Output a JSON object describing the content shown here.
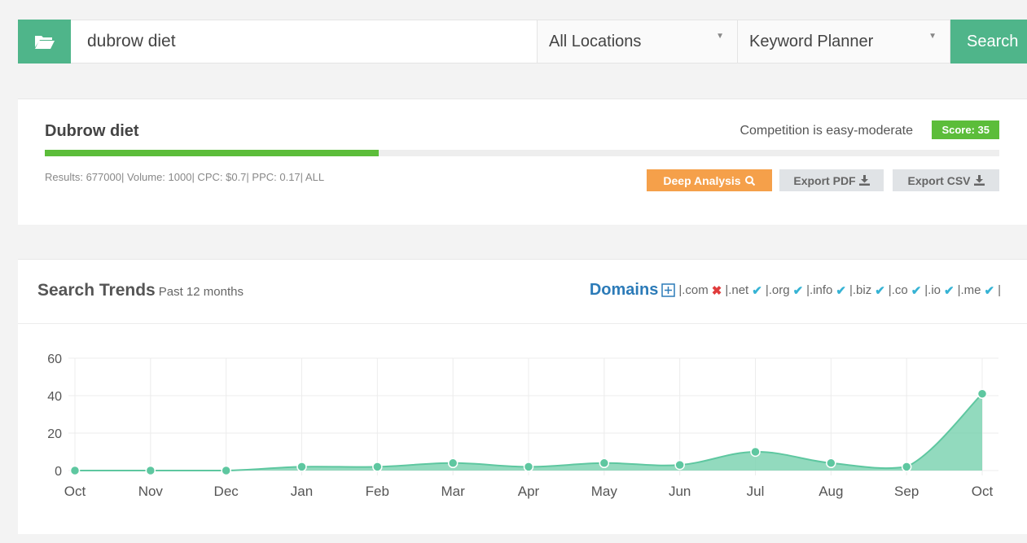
{
  "search": {
    "query": "dubrow diet",
    "location": "All Locations",
    "source": "Keyword Planner",
    "button_label": "Search"
  },
  "keyword": {
    "title": "Dubrow diet",
    "competition": "Competition is easy-moderate",
    "score": "Score: 35",
    "difficulty_fraction": 0.35,
    "stats": "Results: 677000| Volume: 1000| CPC: $0.7| PPC: 0.17| ALL",
    "deep_label": "Deep Analysis",
    "pdf_label": "Export PDF",
    "csv_label": "Export CSV"
  },
  "trends": {
    "title": "Search Trends",
    "subtitle": "Past 12 months",
    "domains_label": "Domains",
    "domains": [
      {
        "tld": "|.com",
        "available": false
      },
      {
        "tld": "|.net",
        "available": true
      },
      {
        "tld": "|.org",
        "available": true
      },
      {
        "tld": "|.info",
        "available": true
      },
      {
        "tld": "|.biz",
        "available": true
      },
      {
        "tld": "|.co",
        "available": true
      },
      {
        "tld": "|.io",
        "available": true
      },
      {
        "tld": "|.me",
        "available": true
      }
    ],
    "trailing": "|"
  },
  "colors": {
    "brand": "#4fb58a",
    "score": "#5cbd3a",
    "deep": "#f5a04a",
    "area_fill": "#7fd3b3",
    "area_line": "#5ec7a0"
  },
  "chart_data": {
    "type": "area",
    "categories": [
      "Oct",
      "Nov",
      "Dec",
      "Jan",
      "Feb",
      "Mar",
      "Apr",
      "May",
      "Jun",
      "Jul",
      "Aug",
      "Sep",
      "Oct"
    ],
    "values": [
      0,
      0,
      0,
      2,
      2,
      4,
      2,
      4,
      3,
      10,
      4,
      2,
      41
    ],
    "yticks": [
      0,
      20,
      40,
      60
    ],
    "ylim": [
      0,
      60
    ],
    "grid": true
  }
}
